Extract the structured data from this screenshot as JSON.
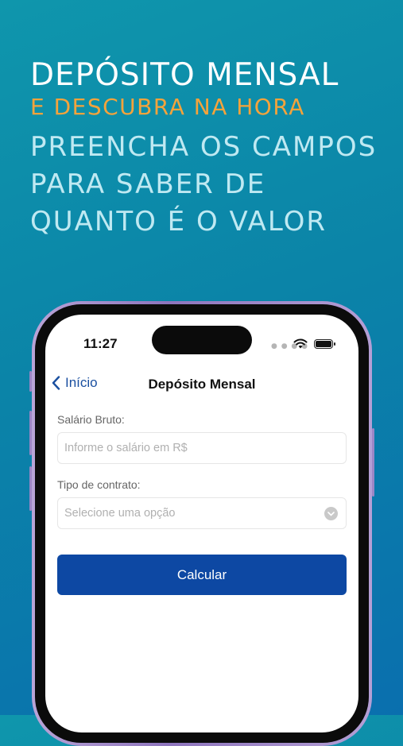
{
  "promo": {
    "title": "DEPÓSITO MENSAL",
    "subtitle": "E DESCUBRA NA HORA",
    "description": "PREENCHA OS CAMPOS\nPARA SABER DE\nQUANTO É O VALOR"
  },
  "status_bar": {
    "time": "11:27",
    "signal_icon": "signal-dots-icon",
    "wifi_icon": "wifi-icon",
    "battery_icon": "battery-icon"
  },
  "navbar": {
    "back_label": "Início",
    "title": "Depósito Mensal"
  },
  "form": {
    "salary_label": "Salário Bruto:",
    "salary_placeholder": "Informe o salário em R$",
    "contract_label": "Tipo de contrato:",
    "contract_placeholder": "Selecione uma opção",
    "submit_label": "Calcular"
  },
  "colors": {
    "background_top": "#0f96ac",
    "background_bottom": "#0a6fae",
    "title": "#ffffff",
    "subtitle": "#f5a33b",
    "description": "#bfe9f2",
    "accent_blue": "#1a4fa0",
    "button": "#0d48a3"
  }
}
